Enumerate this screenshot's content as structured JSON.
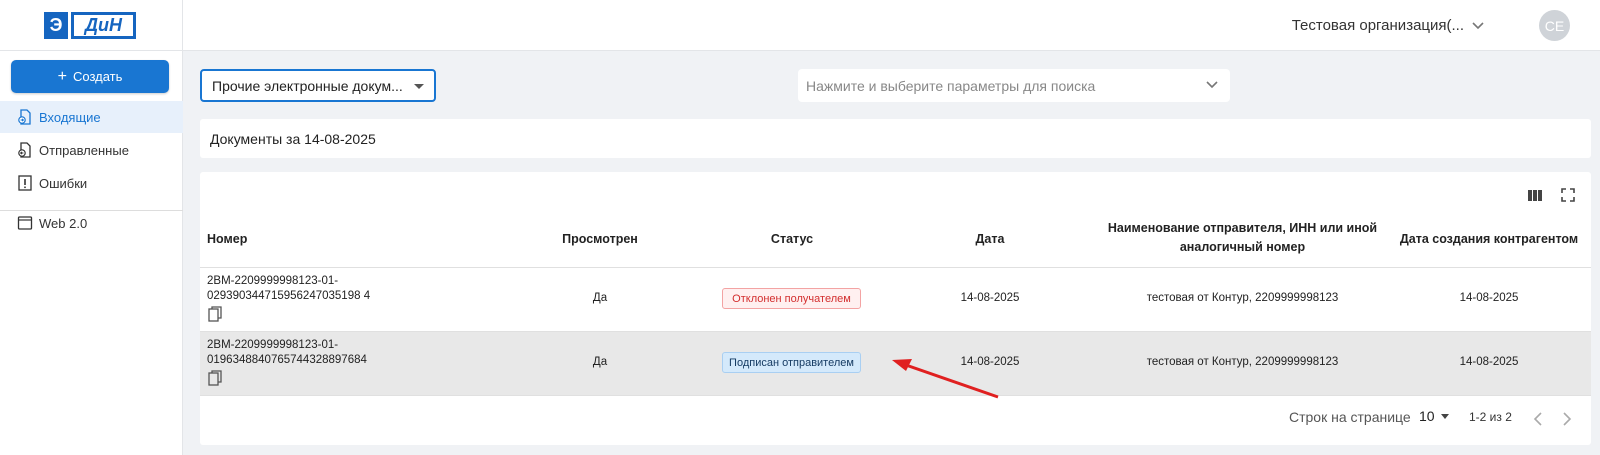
{
  "header": {
    "logo_letter": "Э",
    "logo_text": "ДиН",
    "organization": "Тестовая организация(...",
    "avatar_initials": "CE"
  },
  "sidebar": {
    "create_label": "Создать",
    "items": [
      {
        "label": "Входящие",
        "active": true
      },
      {
        "label": "Отправленные",
        "active": false
      },
      {
        "label": "Ошибки",
        "active": false
      },
      {
        "label": "Web 2.0",
        "active": false
      }
    ]
  },
  "controls": {
    "doc_type": "Прочие электронные докум...",
    "search_placeholder": "Нажмите и выберите параметры для поиска"
  },
  "docs_date_title": "Документы за 14-08-2025",
  "table": {
    "columns": [
      "Номер",
      "Просмотрен",
      "Статус",
      "Дата",
      "Наименование отправителя, ИНН или иной аналогичный номер",
      "Дата создания контрагентом"
    ],
    "rows": [
      {
        "number_line1": "2BM-2209999998123-01-",
        "number_line2": "029390344715956247035198 4",
        "viewed": "Да",
        "status": "Отклонен получателем",
        "status_kind": "rejected",
        "date": "14-08-2025",
        "sender": "тестовая от Контур, 2209999998123",
        "created": "14-08-2025"
      },
      {
        "number_line1": "2BM-2209999998123-01-",
        "number_line2": "0196348840765744328897684",
        "viewed": "Да",
        "status": "Подписан отправителем",
        "status_kind": "signed",
        "date": "14-08-2025",
        "sender": "тестовая от Контур, 2209999998123",
        "created": "14-08-2025",
        "highlighted": true
      }
    ]
  },
  "pagination": {
    "rows_per_page_label": "Строк на странице",
    "rows_per_page": "10",
    "range": "1-2 из 2"
  },
  "colors": {
    "accent": "#1976d2",
    "annotation_arrow": "#e02020"
  }
}
